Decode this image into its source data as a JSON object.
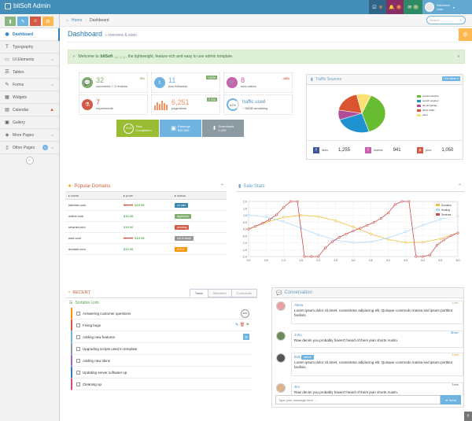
{
  "header": {
    "brand": "bitSoft Admin",
    "messages_count": "4",
    "notif_count": "8",
    "mail_count": "5",
    "user_welcome": "Welcome,",
    "user_name": "User"
  },
  "sidebar": {
    "items": [
      {
        "label": "Dashboard",
        "icon": "dashboard-icon"
      },
      {
        "label": "Typography",
        "icon": "text-icon"
      },
      {
        "label": "UI Elements",
        "icon": "desktop-icon"
      },
      {
        "label": "Tables",
        "icon": "list-icon"
      },
      {
        "label": "Forms",
        "icon": "edit-icon"
      },
      {
        "label": "Widgets",
        "icon": "widgets-icon"
      },
      {
        "label": "Calendar",
        "icon": "calendar-icon"
      },
      {
        "label": "Gallery",
        "icon": "picture-icon"
      },
      {
        "label": "More Pages",
        "icon": "tag-icon"
      },
      {
        "label": "Other Pages",
        "icon": "file-icon",
        "badge": "5"
      }
    ]
  },
  "breadcrumbs": {
    "home": "Home",
    "current": "Dashboard"
  },
  "search": {
    "placeholder": "Search ..."
  },
  "page": {
    "title": "Dashboard",
    "subtitle": "» overview & stats"
  },
  "alert": {
    "prefix": "Welcome to",
    "brand": "bitSoft",
    "version": "(v1.1.3)",
    "rest": ", the lightweight, feature-rich and easy to use admin template."
  },
  "infoboxes": [
    {
      "value": "32",
      "label": "comments + 2 reviews",
      "stat": "8%"
    },
    {
      "value": "11",
      "label": "new followers",
      "stat": "+32%"
    },
    {
      "value": "8",
      "label": "new orders",
      "stat": "-18%"
    },
    {
      "value": "7",
      "label": "experiments",
      "stat": ""
    },
    {
      "value": "6,251",
      "label": "pageviews",
      "stat": "7.2%"
    },
    {
      "value": "traffic used",
      "label": "~ 58GB remaining",
      "stat": "42%"
    }
  ],
  "bigbuttons": [
    {
      "pct": "61%",
      "line1": "Task",
      "line2": "Completion"
    },
    {
      "line1": "Earnings",
      "line2": "$32,000"
    },
    {
      "line1": "Downloads",
      "line2": "1,205"
    }
  ],
  "traffic": {
    "title": "Traffic Sources",
    "dropdown": "This Week"
  },
  "social": [
    {
      "label": "likes",
      "value": "1,255"
    },
    {
      "label": "tweets",
      "value": "941"
    },
    {
      "label": "pins",
      "value": "1,050"
    }
  ],
  "domains": {
    "title": "Popular Domains",
    "headers": [
      "name",
      "price",
      "status"
    ],
    "rows": [
      {
        "name": "internet.com",
        "old": "$29.99",
        "price": "$19.99",
        "status": "on sale",
        "color": "#3a87ad"
      },
      {
        "name": "online.com",
        "old": "",
        "price": "$16.45",
        "status": "approved",
        "color": "#82af6f"
      },
      {
        "name": "newnet.com",
        "old": "",
        "price": "$15.00",
        "status": "pending",
        "color": "#d15b47"
      },
      {
        "name": "web.com",
        "old": "$24.99",
        "price": "$19.95",
        "status": "out of stock",
        "color": "#999999"
      },
      {
        "name": "domain.com",
        "old": "",
        "price": "$12.00",
        "status": "SOLD",
        "color": "#f89406"
      }
    ]
  },
  "salestats": {
    "title": "Sale Stats"
  },
  "recent": {
    "title": "RECENT",
    "tabs": [
      "Tasks",
      "Members",
      "Comments"
    ],
    "list_title": "Sortable Lists",
    "tasks": [
      "Answering customer questions",
      "Fixing bugs",
      "Adding new features",
      "Upgrading scripts used in template",
      "Adding new skins",
      "Updating server software up",
      "Cleaning up"
    ],
    "task_pct": "62%"
  },
  "conversation": {
    "title": "Conversation",
    "messages": [
      {
        "name": "Alexa",
        "time": "4 sec",
        "text": "Lorem ipsum dolor sit amet, consectetur adipiscing elit. Quisque commodo massa sed ipsum porttitor facilisis."
      },
      {
        "name": "John",
        "time": "38 sec",
        "text": "Raw denim you probably haven't heard of them jean shorts Austin."
      },
      {
        "name": "Bob",
        "badge": "admin",
        "time": "2 min",
        "text": "Lorem ipsum dolor sit amet, consectetur adipiscing elit. Quisque commodo massa sed ipsum porttitor facilisis."
      },
      {
        "name": "Jim",
        "time": "3 min",
        "text": "Raw denim you probably haven't heard of them jean shorts Austin."
      }
    ],
    "input_placeholder": "Type your message here ...",
    "send": "Send"
  },
  "chart_data": [
    {
      "type": "pie",
      "title": "Traffic Sources",
      "categories": [
        "social networks",
        "search engines",
        "ad campaings",
        "direct traffic",
        "other"
      ],
      "values": [
        38.7,
        24.5,
        8.2,
        18.6,
        10
      ],
      "colors": [
        "#68bc31",
        "#2091cf",
        "#af4e96",
        "#da5430",
        "#fee074"
      ]
    },
    {
      "type": "line",
      "title": "Sale Stats",
      "xlim": [
        0,
        6
      ],
      "ylim": [
        -2,
        2
      ],
      "xticks": [
        "0.0",
        "0.5",
        "1.0",
        "1.5",
        "2.0",
        "2.5",
        "3.0",
        "3.5",
        "4.0",
        "4.5",
        "5.0",
        "5.5",
        "6.0"
      ],
      "yticks": [
        "2.0",
        "1.5",
        "1.0",
        "0.5",
        "0.0",
        "-0.5",
        "-1.0",
        "-1.5",
        "-2.0"
      ],
      "series": [
        {
          "name": "Domains",
          "color": "#edc240",
          "x": [
            0,
            0.5,
            1,
            1.5,
            2,
            2.5,
            3,
            3.5,
            4,
            4.5,
            5,
            5.5,
            6
          ],
          "y": [
            0,
            0.48,
            0.84,
            1,
            0.91,
            0.6,
            0.14,
            -0.35,
            -0.76,
            -0.98,
            -0.96,
            -0.71,
            -0.28
          ]
        },
        {
          "name": "Hosting",
          "color": "#afd8f8",
          "x": [
            0,
            0.5,
            1,
            1.5,
            2,
            2.5,
            3,
            3.5,
            4,
            4.5,
            5,
            5.5,
            6
          ],
          "y": [
            1,
            0.88,
            0.54,
            0.07,
            -0.42,
            -0.8,
            -0.99,
            -0.94,
            -0.65,
            -0.21,
            0.28,
            0.71,
            0.96
          ]
        },
        {
          "name": "Services",
          "color": "#cb4b4b",
          "x": [
            0,
            0.2,
            0.4,
            0.6,
            0.8,
            1,
            1.2,
            1.4,
            1.6,
            1.8,
            2,
            2.2,
            2.4,
            2.6,
            2.8,
            3,
            3.2,
            3.4,
            3.6,
            3.8,
            4,
            4.2,
            4.4,
            4.6,
            4.8,
            5,
            5.2,
            5.4,
            5.6,
            5.8,
            6
          ],
          "y": [
            0,
            0.2,
            0.42,
            0.68,
            1.03,
            1.56,
            2.0,
            2.0,
            -2.0,
            -2.0,
            -2.0,
            -1.37,
            -0.92,
            -0.6,
            -0.36,
            -0.14,
            0.06,
            0.27,
            0.49,
            0.78,
            1.16,
            1.78,
            2.0,
            2.0,
            -2.0,
            -2.0,
            -1.89,
            -1.18,
            -0.79,
            -0.5,
            -0.29
          ]
        }
      ]
    }
  ]
}
